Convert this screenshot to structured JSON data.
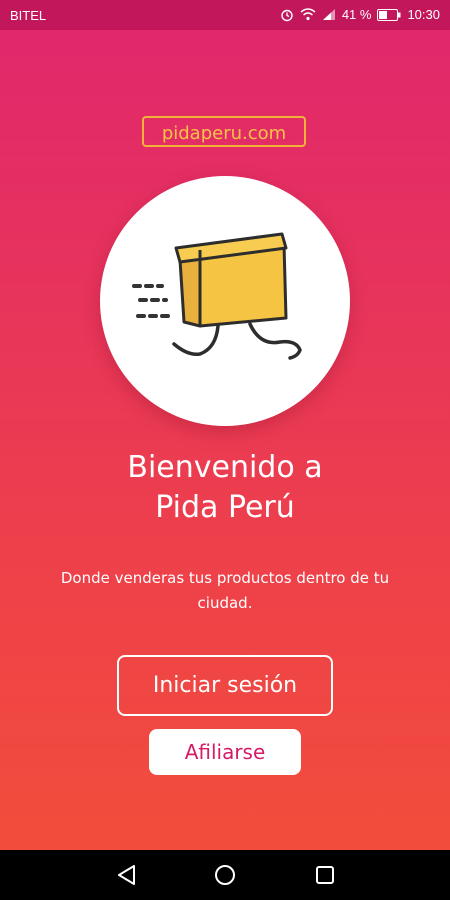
{
  "status_bar": {
    "carrier": "BITEL",
    "battery_percent": "41 %",
    "time": "10:30",
    "icons": [
      "alarm-icon",
      "wifi-icon",
      "signal-icon",
      "battery-icon"
    ]
  },
  "brand": {
    "label": "pidaperu.com"
  },
  "hero": {
    "illustration": "running-box-icon"
  },
  "welcome": {
    "title_line1": "Bienvenido a",
    "title_line2": "Pida Perú",
    "subtitle": "Donde venderas tus productos dentro de tu ciudad."
  },
  "actions": {
    "login_label": "Iniciar sesión",
    "register_label": "Afiliarse"
  },
  "nav": {
    "icons": [
      "back-icon",
      "home-icon",
      "recents-icon"
    ]
  },
  "colors": {
    "gradient_top": "#e0266e",
    "gradient_bottom": "#f24d3c",
    "brand_gold": "#f6c445",
    "register_text": "#d51b66",
    "box_yellow": "#f5c443"
  }
}
